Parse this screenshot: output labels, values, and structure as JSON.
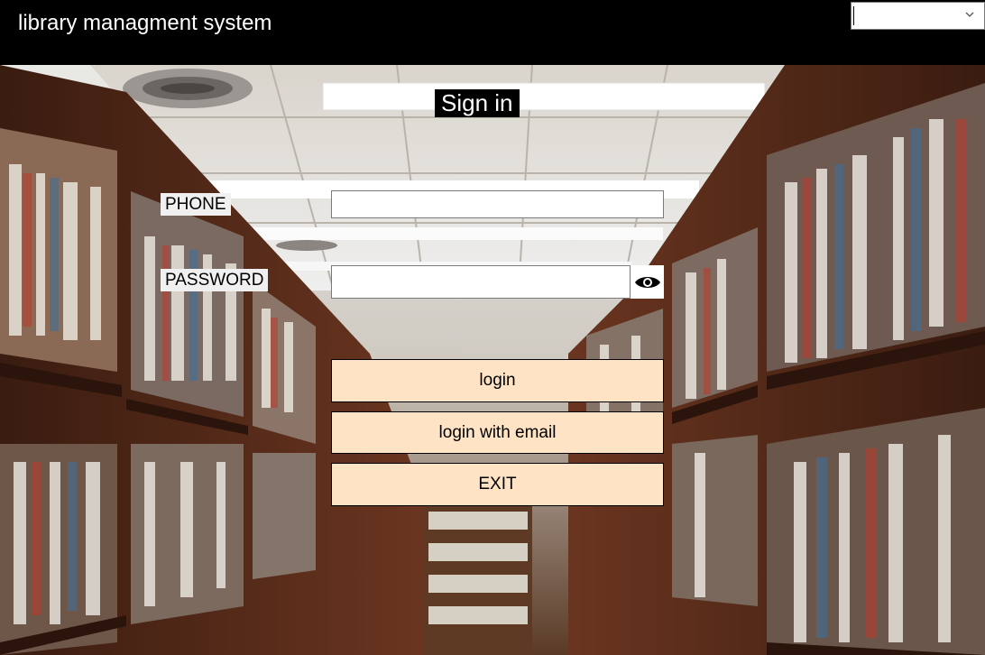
{
  "app": {
    "title": "library managment system"
  },
  "language_select": {
    "value": "",
    "icon": "chevron-down-icon"
  },
  "form": {
    "heading": "Sign in",
    "phone_label": "PHONE",
    "phone_value": "",
    "password_label": "PASSWORD",
    "password_value": "",
    "show_password_icon": "eye-icon"
  },
  "buttons": {
    "login": "login",
    "login_email": "login with email",
    "exit": "EXIT"
  },
  "colors": {
    "topbar": "#000000",
    "button_bg": "#ffe3c4",
    "label_bg": "#f0f0f0"
  }
}
